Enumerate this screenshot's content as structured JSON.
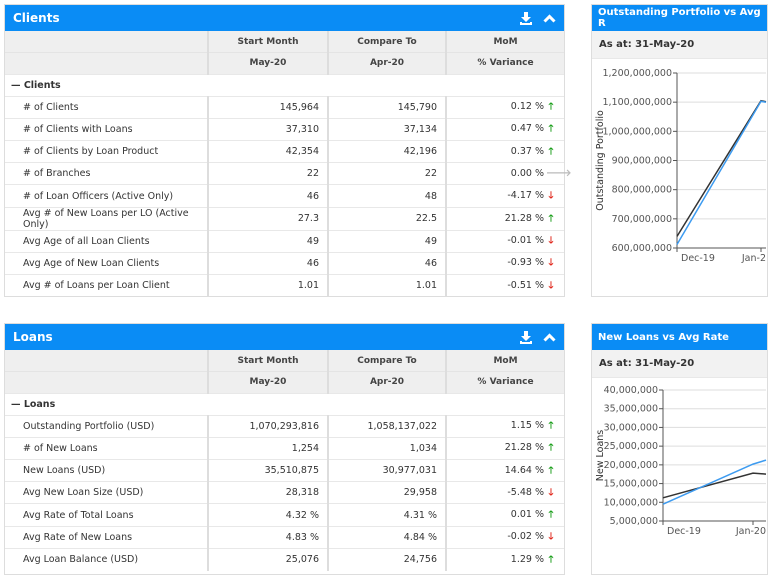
{
  "clients": {
    "title": "Clients",
    "headers": [
      "Start Month",
      "Compare To",
      "MoM"
    ],
    "subheaders": [
      "May-20",
      "Apr-20",
      "% Variance"
    ],
    "group": "Clients",
    "rows": [
      {
        "label": "# of Clients",
        "start": "145,964",
        "compare": "145,790",
        "variance": "0.12 %",
        "trend": "up"
      },
      {
        "label": "# of Clients with Loans",
        "start": "37,310",
        "compare": "37,134",
        "variance": "0.47 %",
        "trend": "up"
      },
      {
        "label": "# of Clients by Loan Product",
        "start": "42,354",
        "compare": "42,196",
        "variance": "0.37 %",
        "trend": "up"
      },
      {
        "label": "# of Branches",
        "start": "22",
        "compare": "22",
        "variance": "0.00 %",
        "trend": "flat"
      },
      {
        "label": "# of Loan Officers (Active Only)",
        "start": "46",
        "compare": "48",
        "variance": "-4.17 %",
        "trend": "down"
      },
      {
        "label": "Avg # of New Loans per LO (Active Only)",
        "start": "27.3",
        "compare": "22.5",
        "variance": "21.28 %",
        "trend": "up"
      },
      {
        "label": "Avg Age of all Loan Clients",
        "start": "49",
        "compare": "49",
        "variance": "-0.01 %",
        "trend": "down"
      },
      {
        "label": "Avg Age of New Loan Clients",
        "start": "46",
        "compare": "46",
        "variance": "-0.93 %",
        "trend": "down"
      },
      {
        "label": "Avg # of Loans per Loan Client",
        "start": "1.01",
        "compare": "1.01",
        "variance": "-0.51 %",
        "trend": "down"
      }
    ]
  },
  "loans": {
    "title": "Loans",
    "headers": [
      "Start Month",
      "Compare To",
      "MoM"
    ],
    "subheaders": [
      "May-20",
      "Apr-20",
      "% Variance"
    ],
    "group": "Loans",
    "rows": [
      {
        "label": "Outstanding Portfolio (USD)",
        "start": "1,070,293,816",
        "compare": "1,058,137,022",
        "variance": "1.15 %",
        "trend": "up"
      },
      {
        "label": "# of New Loans",
        "start": "1,254",
        "compare": "1,034",
        "variance": "21.28 %",
        "trend": "up"
      },
      {
        "label": "New Loans (USD)",
        "start": "35,510,875",
        "compare": "30,977,031",
        "variance": "14.64 %",
        "trend": "up"
      },
      {
        "label": "Avg New Loan Size (USD)",
        "start": "28,318",
        "compare": "29,958",
        "variance": "-5.48 %",
        "trend": "down"
      },
      {
        "label": "Avg Rate of Total Loans",
        "start": "4.32 %",
        "compare": "4.31 %",
        "variance": "0.01 %",
        "trend": "up"
      },
      {
        "label": "Avg Rate of New Loans",
        "start": "4.83 %",
        "compare": "4.84 %",
        "variance": "-0.02 %",
        "trend": "down"
      },
      {
        "label": "Avg Loan Balance (USD)",
        "start": "25,076",
        "compare": "24,756",
        "variance": "1.29 %",
        "trend": "up"
      }
    ]
  },
  "colors": {
    "header": "#0a8cf5",
    "up": "#1a9e1a",
    "down": "#e0261b",
    "flat": "#bbbbbb",
    "series_blue": "#3d9bf0",
    "series_black": "#333333"
  },
  "chart_data": [
    {
      "type": "line",
      "title": "Outstanding Portfolio vs Avg R",
      "subtitle": "As at: 31-May-20",
      "ylabel": "Outstanding Portfolio",
      "ylim": [
        600000000,
        1200000000
      ],
      "yticks": [
        "1,200,000,000",
        "1,100,000,000",
        "1,000,000,000",
        "900,000,000",
        "800,000,000",
        "700,000,000",
        "600,000,000"
      ],
      "categories": [
        "Dec-19",
        "Jan-2"
      ],
      "series": [
        {
          "color": "#333333",
          "values": [
            640000000,
            1105000000
          ]
        },
        {
          "color": "#3d9bf0",
          "values": [
            612000000,
            1103000000
          ]
        }
      ],
      "grid": true
    },
    {
      "type": "line",
      "title": "New Loans vs Avg Rate",
      "subtitle": "As at: 31-May-20",
      "ylabel": "New Loans",
      "ylim": [
        5000000,
        40000000
      ],
      "yticks": [
        "40,000,000",
        "35,000,000",
        "30,000,000",
        "25,000,000",
        "20,000,000",
        "15,000,000",
        "10,000,000",
        "5,000,000"
      ],
      "categories": [
        "Dec-19",
        "Jan-20"
      ],
      "series": [
        {
          "color": "#333333",
          "values": [
            11200000,
            17800000
          ]
        },
        {
          "color": "#3d9bf0",
          "values": [
            9500000,
            20200000
          ]
        }
      ],
      "grid": true
    }
  ]
}
